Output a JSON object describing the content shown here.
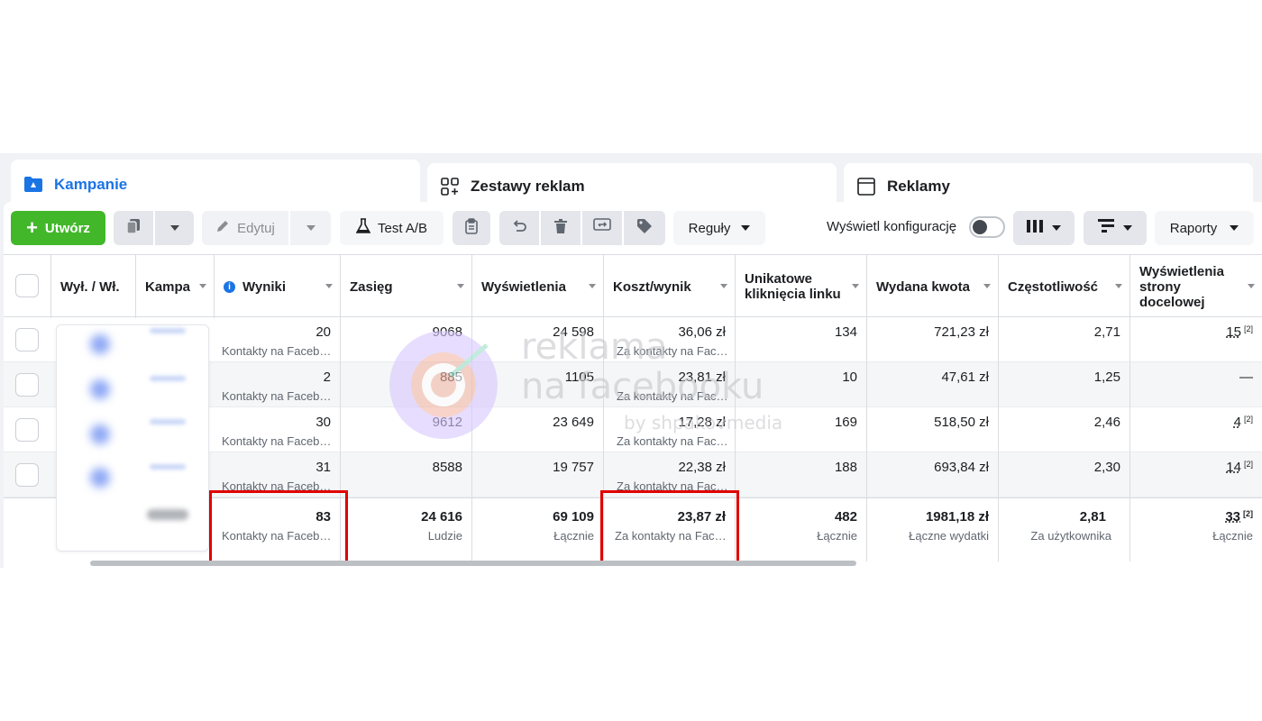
{
  "tabs": [
    {
      "label": "Kampanie",
      "icon": "folder-icon"
    },
    {
      "label": "Zestawy reklam",
      "icon": "grid-icon"
    },
    {
      "label": "Reklamy",
      "icon": "window-icon"
    }
  ],
  "toolbar": {
    "create_label": "Utwórz",
    "edit_label": "Edytuj",
    "abtest_label": "Test A/B",
    "rules_label": "Reguły",
    "config_label": "Wyświetl konfigurację",
    "config_on": false,
    "reports_label": "Raporty"
  },
  "columns": [
    {
      "label": "Wył. / Wł."
    },
    {
      "label": "Kampa"
    },
    {
      "label": "Wyniki"
    },
    {
      "label": "Zasięg"
    },
    {
      "label": "Wyświetlenia"
    },
    {
      "label": "Koszt/wynik"
    },
    {
      "label": "Unikatowe kliknięcia linku"
    },
    {
      "label": "Wydana kwota"
    },
    {
      "label": "Częstotliwość"
    },
    {
      "label": "Wyświetlenia strony docelowej"
    }
  ],
  "rows": [
    {
      "wyniki": "20",
      "wyniki_sub": "Kontakty na Faceb…",
      "zasieg": "9068",
      "wysw": "24 598",
      "koszt": "36,06 zł",
      "koszt_sub": "Za kontakty na Fac…",
      "klik": "134",
      "kwota": "721,23 zł",
      "czest": "2,71",
      "strona": "15",
      "strona_sup": "[2]"
    },
    {
      "wyniki": "2",
      "wyniki_sub": "Kontakty na Faceb…",
      "zasieg": "885",
      "wysw": "1105",
      "koszt": "23,81 zł",
      "koszt_sub": "Za kontakty na Fac…",
      "klik": "10",
      "kwota": "47,61 zł",
      "czest": "1,25",
      "strona": "—",
      "strona_sup": ""
    },
    {
      "wyniki": "30",
      "wyniki_sub": "Kontakty na Faceb…",
      "zasieg": "9612",
      "wysw": "23 649",
      "koszt": "17,28 zł",
      "koszt_sub": "Za kontakty na Fac…",
      "klik": "169",
      "kwota": "518,50 zł",
      "czest": "2,46",
      "strona": "4",
      "strona_sup": "[2]"
    },
    {
      "wyniki": "31",
      "wyniki_sub": "Kontakty na Faceb…",
      "zasieg": "8588",
      "wysw": "19 757",
      "koszt": "22,38 zł",
      "koszt_sub": "Za kontakty na Fac…",
      "klik": "188",
      "kwota": "693,84 zł",
      "czest": "2,30",
      "strona": "14",
      "strona_sup": "[2]"
    }
  ],
  "totals": {
    "wyniki": "83",
    "wyniki_sub": "Kontakty na Facebo…",
    "zasieg": "24 616",
    "zasieg_sub": "Ludzie",
    "wysw": "69 109",
    "wysw_sub": "Łącznie",
    "koszt": "23,87 zł",
    "koszt_sub": "Za kontakty na Face…",
    "klik": "482",
    "klik_sub": "Łącznie",
    "kwota": "1981,18 zł",
    "kwota_sub": "Łączne wydatki",
    "czest": "2,81",
    "czest_sub": "Za użytkownika",
    "strona": "33",
    "strona_sup": "[2]",
    "strona_sub": "Łącznie"
  },
  "watermark": {
    "line1": "reklama",
    "line2": "na facebooku",
    "line3": "by shpakovmedia"
  },
  "colors": {
    "accent": "#1b74e4",
    "create": "#42b72a",
    "highlight": "#e00000"
  }
}
